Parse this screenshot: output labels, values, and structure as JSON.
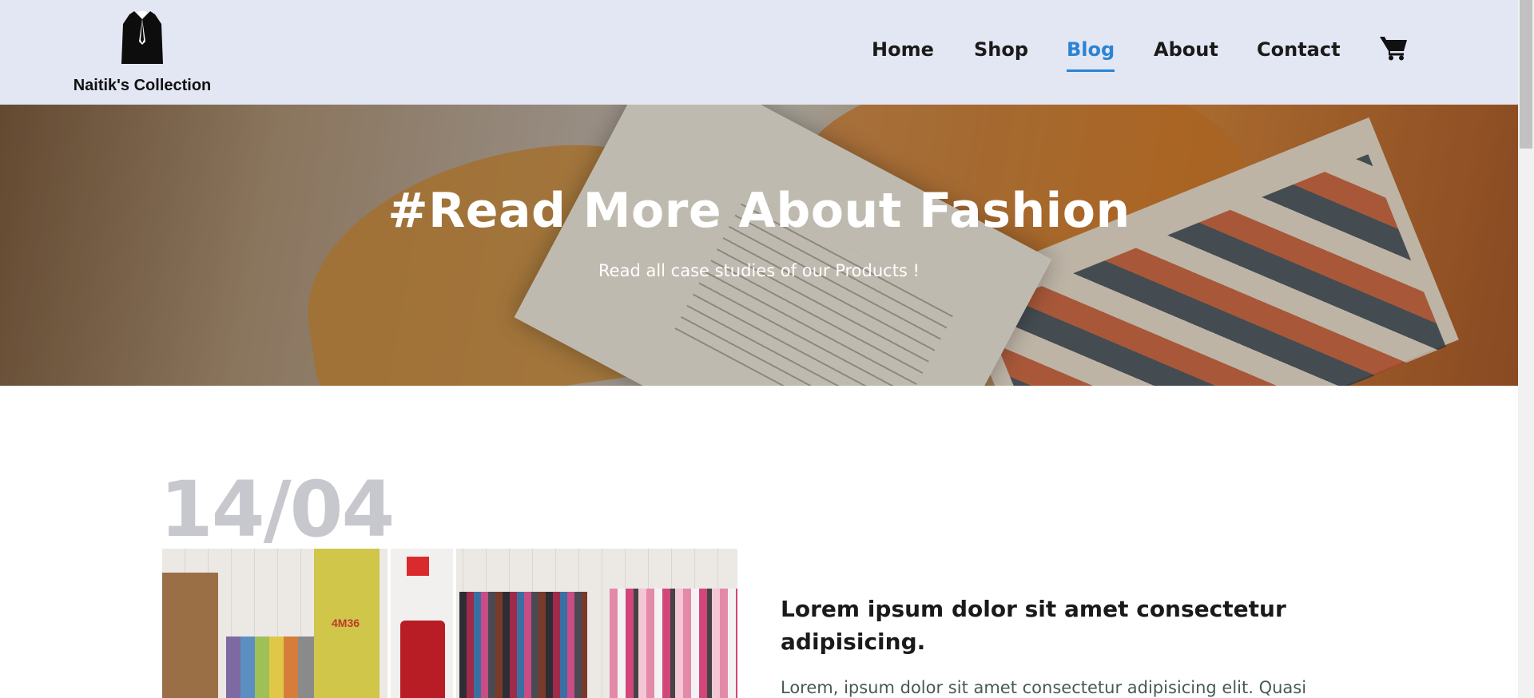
{
  "header": {
    "logo_text": "Naitik's Collection",
    "nav": [
      {
        "label": "Home",
        "active": false
      },
      {
        "label": "Shop",
        "active": false
      },
      {
        "label": "Blog",
        "active": true
      },
      {
        "label": "About",
        "active": false
      },
      {
        "label": "Contact",
        "active": false
      }
    ],
    "cart_icon": "shopping-cart-icon",
    "logo_icon": "suit-jacket-icon"
  },
  "hero": {
    "title": "#Read More About Fashion",
    "subtitle": "Read all case studies of our Products !"
  },
  "blog": {
    "date": "14/04",
    "post_title": "Lorem ipsum dolor sit amet consectetur adipisicing.",
    "post_excerpt": "Lorem, ipsum dolor sit amet consectetur adipisicing elit. Quasi",
    "image_text": "4M36"
  },
  "colors": {
    "header_bg": "#e3e6f3",
    "active_link": "#2a84d4",
    "date_color": "#c7c7ce",
    "excerpt_color": "#465b52"
  }
}
